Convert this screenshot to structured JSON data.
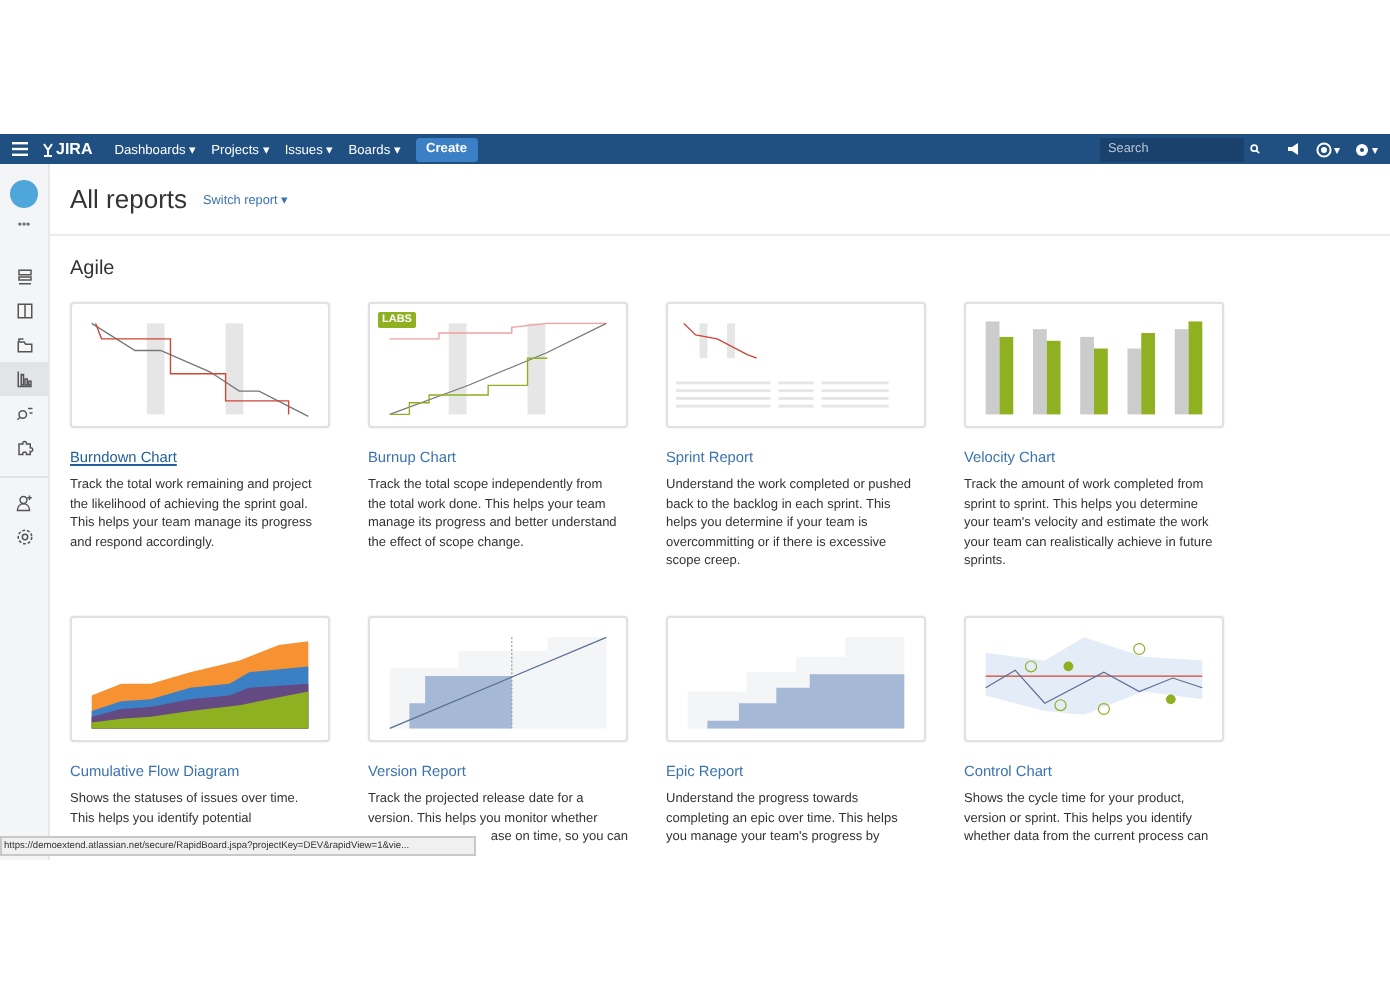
{
  "nav": {
    "logo": "JIRA",
    "menus": [
      {
        "label": "Dashboards",
        "caret": "▾"
      },
      {
        "label": "Projects",
        "caret": "▾"
      },
      {
        "label": "Issues",
        "caret": "▾"
      },
      {
        "label": "Boards",
        "caret": "▾"
      }
    ],
    "create": "Create",
    "search": {
      "placeholder": "Search"
    },
    "carets": [
      "▾",
      "▾"
    ]
  },
  "sidebar": {
    "more": "•••",
    "items": [
      {
        "selected": false
      },
      {
        "selected": false
      },
      {
        "selected": false
      },
      {
        "selected": true
      },
      {
        "selected": false
      },
      {
        "selected": false
      }
    ],
    "bottom_items": [
      {
        "selected": false
      },
      {
        "selected": false
      }
    ]
  },
  "header": {
    "title": "All reports",
    "switch": "Switch report ▾"
  },
  "section": "Agile",
  "cards": [
    {
      "kind": "burndown",
      "title": "Burndown Chart",
      "hovered": true,
      "description": "Track the total work remaining and project the likelihood of achieving the sprint goal. This helps your team manage its progress and respond accordingly."
    },
    {
      "kind": "burnup",
      "title": "Burnup Chart",
      "hovered": false,
      "badge": "LABS",
      "description": "Track the total scope independently from the total work done. This helps your team manage its progress and better understand the effect of scope change."
    },
    {
      "kind": "sprint",
      "title": "Sprint Report",
      "hovered": false,
      "description": "Understand the work completed or pushed back to the backlog in each sprint. This helps you determine if your team is overcommitting or if there is excessive scope creep."
    },
    {
      "kind": "velocity",
      "title": "Velocity Chart",
      "hovered": false,
      "description": "Track the amount of work completed from sprint to sprint. This helps you determine your team's velocity and estimate the work your team can realistically achieve in future sprints."
    },
    {
      "kind": "cfd",
      "title": "Cumulative Flow Diagram",
      "hovered": false,
      "description": "Shows the statuses of issues over time. This helps you identify potential"
    },
    {
      "kind": "version",
      "title": "Version Report",
      "hovered": false,
      "description": "Track the projected release date for a version. This helps you monitor whether",
      "fragment": "ase on time, so you can"
    },
    {
      "kind": "epic",
      "title": "Epic Report",
      "hovered": false,
      "description": "Understand the progress towards completing an epic over time. This helps you manage your team's progress by"
    },
    {
      "kind": "control",
      "title": "Control Chart",
      "hovered": false,
      "description": "Shows the cycle time for your product, version or sprint. This helps you identify whether data from the current process can"
    }
  ],
  "status_url": "https://demoextend.atlassian.net/secure/RapidBoard.jspa?projectKey=DEV&rapidView=1&vie..."
}
